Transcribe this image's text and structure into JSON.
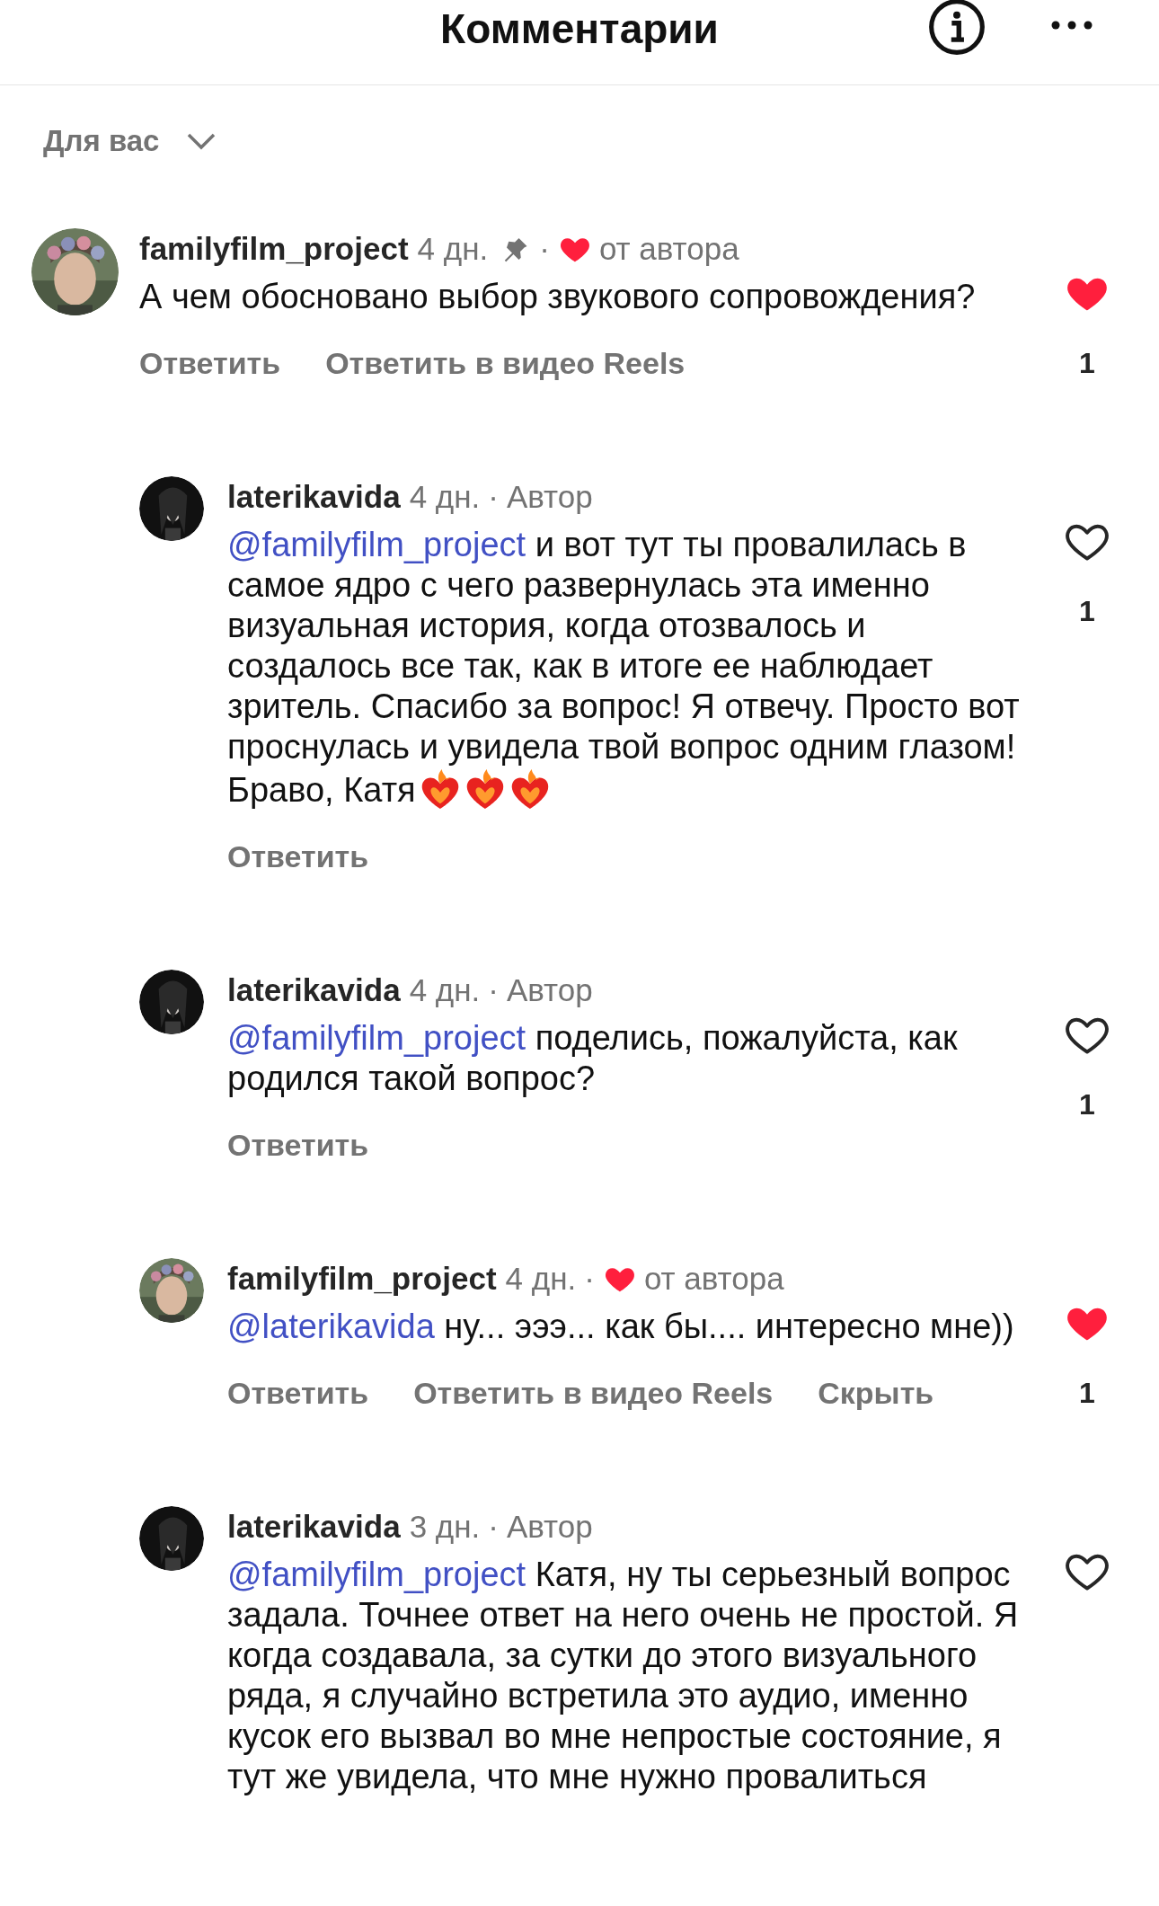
{
  "header": {
    "title": "Комментарии"
  },
  "filter": {
    "label": "Для вас"
  },
  "comments": [
    {
      "username": "familyfilm_project",
      "avatar": {
        "kind": "light"
      },
      "time": "4 дн.",
      "pinned": true,
      "separator": "·",
      "author_liked": true,
      "tag": "от автора",
      "text": "А чем обосновано выбор звукового сопровождения?",
      "liked": true,
      "like_count": "1",
      "actions": [
        "Ответить",
        "Ответить в видео Reels"
      ],
      "children": [
        {
          "username": "laterikavida",
          "avatar": {
            "kind": "dark"
          },
          "time": "4 дн.",
          "pinned": false,
          "separator": "·",
          "author_liked": false,
          "tag": "Автор",
          "mention": "@familyfilm_project",
          "text": "и вот тут ты провалилась в самое ядро с чего развернулась эта именно визуальная  история, когда отозвалось и создалось все так, как в итоге ее наблюдает зритель. Спасибо за вопрос! Я отвечу. Просто вот проснулась и увидела твой вопрос одним глазом! Браво, Катя",
          "emojis": [
            {
              "kind": "heart_on_fire"
            },
            {
              "kind": "heart_on_fire"
            },
            {
              "kind": "heart_on_fire"
            }
          ],
          "liked": false,
          "like_count": "1",
          "actions": [
            "Ответить"
          ]
        },
        {
          "username": "laterikavida",
          "avatar": {
            "kind": "dark"
          },
          "time": "4 дн.",
          "pinned": false,
          "separator": "·",
          "author_liked": false,
          "tag": "Автор",
          "mention": "@familyfilm_project",
          "text": "поделись, пожалуйста, как родился такой вопрос?",
          "liked": false,
          "like_count": "1",
          "actions": [
            "Ответить"
          ]
        },
        {
          "username": "familyfilm_project",
          "avatar": {
            "kind": "light"
          },
          "time": "4 дн.",
          "pinned": false,
          "separator": "·",
          "author_liked": true,
          "tag": "от автора",
          "mention": "@laterikavida",
          "text": "ну... эээ... как бы.... интересно мне))",
          "liked": true,
          "like_count": "1",
          "actions": [
            "Ответить",
            "Ответить в видео Reels",
            "Скрыть"
          ]
        },
        {
          "username": "laterikavida",
          "avatar": {
            "kind": "dark"
          },
          "time": "3 дн.",
          "pinned": false,
          "separator": "·",
          "author_liked": false,
          "tag": "Автор",
          "mention": "@familyfilm_project",
          "text": "Катя, ну ты серьезный вопрос задала. Точнее ответ на него очень не простой. Я когда создавала, за сутки до этого визуального ряда, я случайно встретила это аудио, именно кусок его вызвал во мне непростые состояние, я тут же увидела, что мне нужно провалиться",
          "liked": false
        }
      ]
    }
  ]
}
